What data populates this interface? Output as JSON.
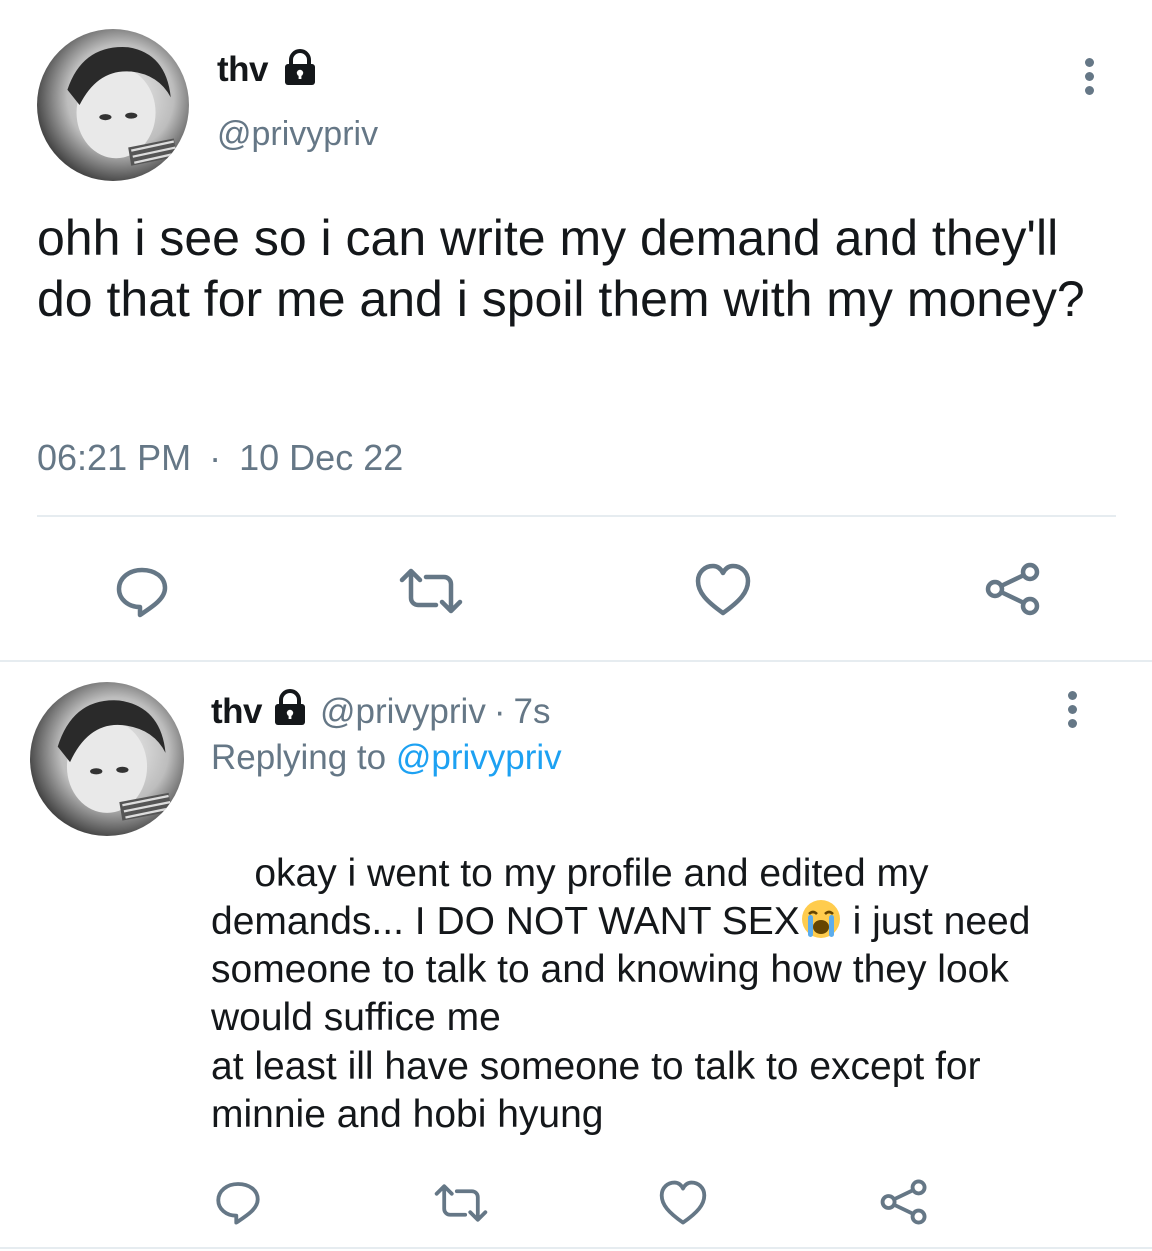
{
  "main_tweet": {
    "author_name": "thv",
    "author_handle": "@privypriv",
    "text": "ohh i see so i can write my demand and they'll do that for me and i spoil them with my money?",
    "time": "06:21 PM",
    "separator": "·",
    "date": "10 Dec 22"
  },
  "reply": {
    "author_name": "thv",
    "author_handle": "@privypriv",
    "meta_separator": "·",
    "age": "7s",
    "replying_prefix": "Replying to",
    "replying_handle": "@privypriv",
    "text_before_emoji": "okay i went to my profile and edited my demands... I DO NOT WANT SEX",
    "text_after_emoji": " i just need someone to talk to and knowing how they look would suffice me",
    "text_paragraph_2": "at least ill have someone to talk to except for minnie and hobi hyung"
  },
  "icons": {
    "lock": "lock-icon",
    "more": "more-options-icon",
    "reply": "reply-icon",
    "retweet": "retweet-icon",
    "like": "like-icon",
    "share": "share-icon",
    "emoji": "loudly-crying-face-emoji"
  },
  "colors": {
    "text": "#14171a",
    "muted": "#657786",
    "link": "#1da1f2",
    "divider": "#e6ecf0",
    "emoji_face": "#ffcc4d",
    "emoji_tears": "#5dadec"
  }
}
